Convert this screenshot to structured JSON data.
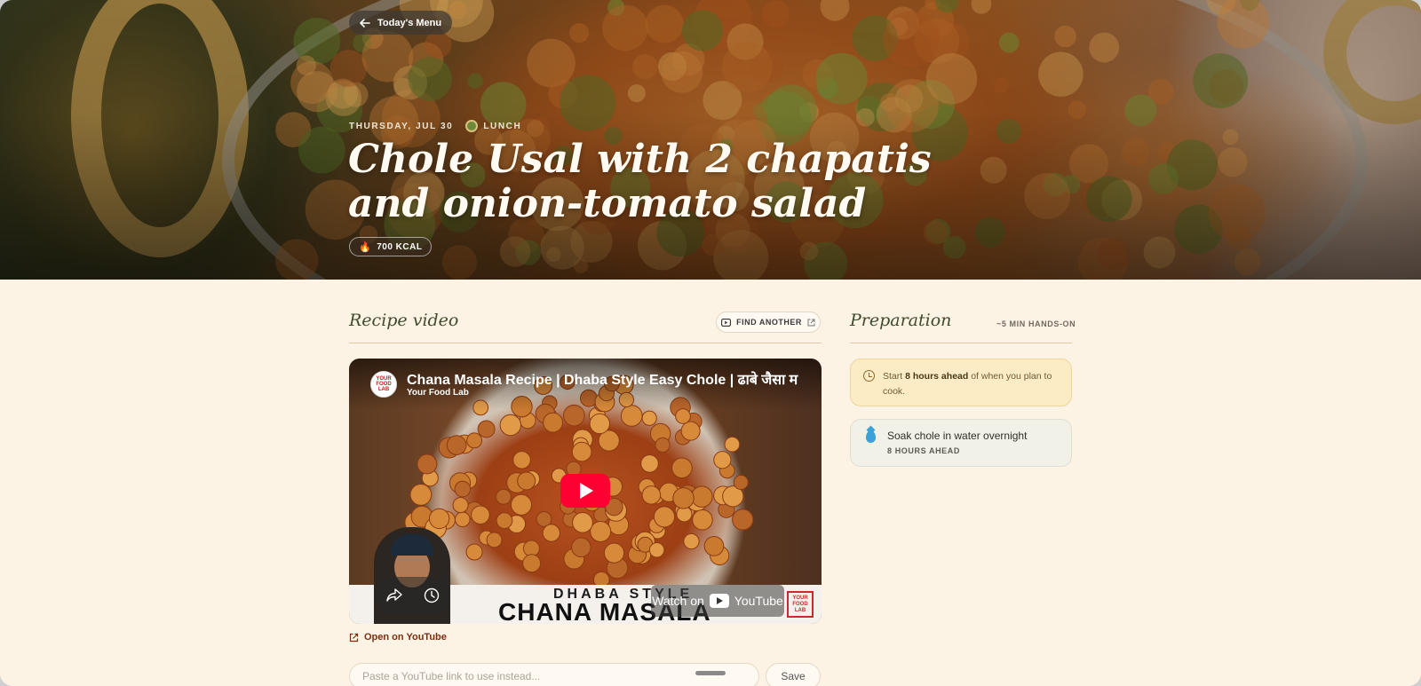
{
  "hero": {
    "back_label": "Today's Menu",
    "date": "THURSDAY, JUL 30",
    "meal": "LUNCH",
    "title": "Chole Usal with 2 chapatis and onion-tomato salad",
    "kcal": "700 KCAL"
  },
  "video_section": {
    "title": "Recipe video",
    "find_another": "FIND ANOTHER",
    "video": {
      "title": "Chana Masala Recipe | Dhaba Style Easy Chole | ढाबे जैसा म",
      "channel": "Your Food Lab",
      "channel_badge": "YOUR FOOD LAB",
      "banner_small": "DHABA STYLE",
      "banner_big": "CHANA MASALA",
      "watch_on": "Watch on",
      "youtube": "YouTube"
    },
    "open_link": "Open on YouTube",
    "input_placeholder": "Paste a YouTube link to use instead...",
    "save_label": "Save"
  },
  "prep": {
    "title": "Preparation",
    "hands_on": "~5 MIN HANDS-ON",
    "ahead_prefix": "Start ",
    "ahead_bold": "8 hours ahead",
    "ahead_suffix": " of when you plan to cook.",
    "steps": [
      {
        "label": "Soak chole in water overnight",
        "timing": "8 HOURS AHEAD",
        "icon": "water-drop-icon"
      }
    ]
  },
  "colors": {
    "background": "#fdf3e4",
    "accent_text": "#7a2e10",
    "heading": "#3e4a2e",
    "youtube_red": "#ff0033"
  }
}
